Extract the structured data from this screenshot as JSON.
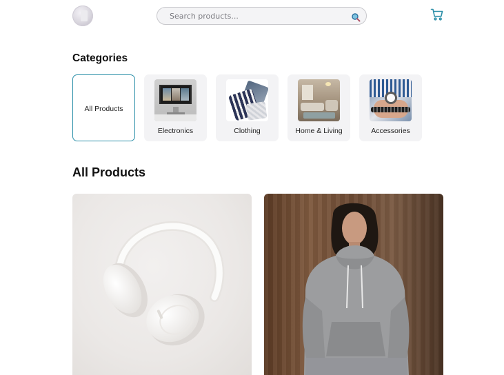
{
  "header": {
    "logo_icon": "store-logo-icon",
    "search": {
      "placeholder": "Search products...",
      "value": "",
      "icon": "search-icon"
    },
    "cart_icon": "cart-icon",
    "accent_color": "#2b8fa8"
  },
  "categories": {
    "title": "Categories",
    "items": [
      {
        "label": "All Products",
        "active": true
      },
      {
        "label": "Electronics",
        "active": false
      },
      {
        "label": "Clothing",
        "active": false
      },
      {
        "label": "Home & Living",
        "active": false
      },
      {
        "label": "Accessories",
        "active": false
      }
    ]
  },
  "products": {
    "title": "All Products",
    "items": [
      {
        "image": "white-headphones-photo"
      },
      {
        "image": "grey-hoodie-model-photo"
      }
    ]
  }
}
